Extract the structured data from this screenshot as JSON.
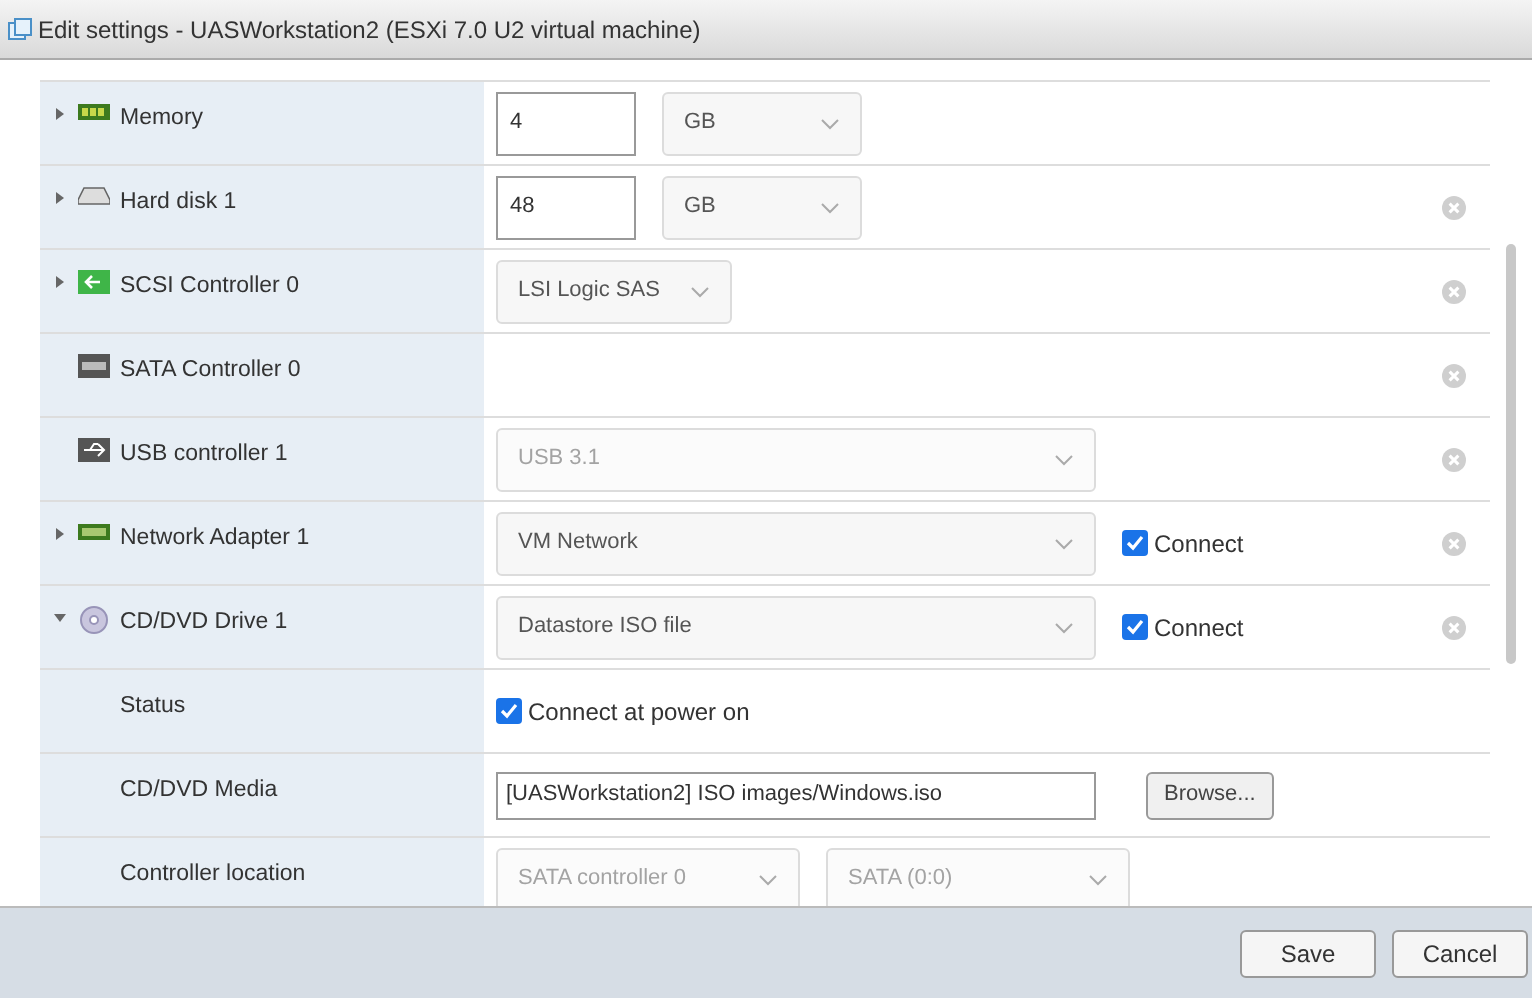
{
  "window": {
    "title": "Edit settings - UASWorkstation2 (ESXi 7.0 U2 virtual machine)"
  },
  "rows": [
    {
      "kind": "memory",
      "label": "Memory",
      "expanded": false,
      "removable": false,
      "controls": [
        {
          "kind": "number",
          "value": "4"
        },
        {
          "kind": "unit-select",
          "value": "GB",
          "disabled": false
        }
      ]
    },
    {
      "kind": "disk",
      "label": "Hard disk 1",
      "expanded": false,
      "removable": true,
      "controls": [
        {
          "kind": "number",
          "value": "48"
        },
        {
          "kind": "unit-select",
          "value": "GB",
          "disabled": false
        }
      ]
    },
    {
      "kind": "scsi",
      "label": "SCSI Controller 0",
      "expanded": false,
      "removable": true,
      "controls": [
        {
          "kind": "short-select",
          "value": "LSI Logic SAS",
          "disabled": false
        }
      ]
    },
    {
      "kind": "sata",
      "label": "SATA Controller 0",
      "removable": true,
      "controls": []
    },
    {
      "kind": "usb",
      "label": "USB controller 1",
      "removable": true,
      "controls": [
        {
          "kind": "select",
          "value": "USB 3.1",
          "disabled": true
        }
      ]
    },
    {
      "kind": "network",
      "label": "Network Adapter 1",
      "expanded": false,
      "removable": true,
      "controls": [
        {
          "kind": "select",
          "value": "VM Network",
          "disabled": false
        },
        {
          "kind": "checkbox",
          "label": "Connect",
          "checked": true
        }
      ]
    },
    {
      "kind": "cd",
      "label": "CD/DVD Drive 1",
      "expanded": true,
      "removable": true,
      "controls": [
        {
          "kind": "select",
          "value": "Datastore ISO file",
          "disabled": false
        },
        {
          "kind": "checkbox",
          "label": "Connect",
          "checked": true
        }
      ]
    },
    {
      "kind": "property",
      "label": "Status",
      "controls": [
        {
          "kind": "checkbox",
          "label": "Connect at power on",
          "checked": true
        }
      ]
    },
    {
      "kind": "property",
      "label": "CD/DVD Media",
      "controls": [
        {
          "kind": "text",
          "value": "[UASWorkstation2] ISO images/Windows.iso"
        },
        {
          "kind": "button",
          "label": "Browse..."
        }
      ]
    },
    {
      "kind": "property",
      "label": "Controller location",
      "controls": [
        {
          "kind": "half-select",
          "value": "SATA controller 0",
          "disabled": true
        },
        {
          "kind": "half-select",
          "value": "SATA (0:0)",
          "disabled": true
        }
      ]
    }
  ],
  "buttons": [
    "Save",
    "Cancel"
  ]
}
